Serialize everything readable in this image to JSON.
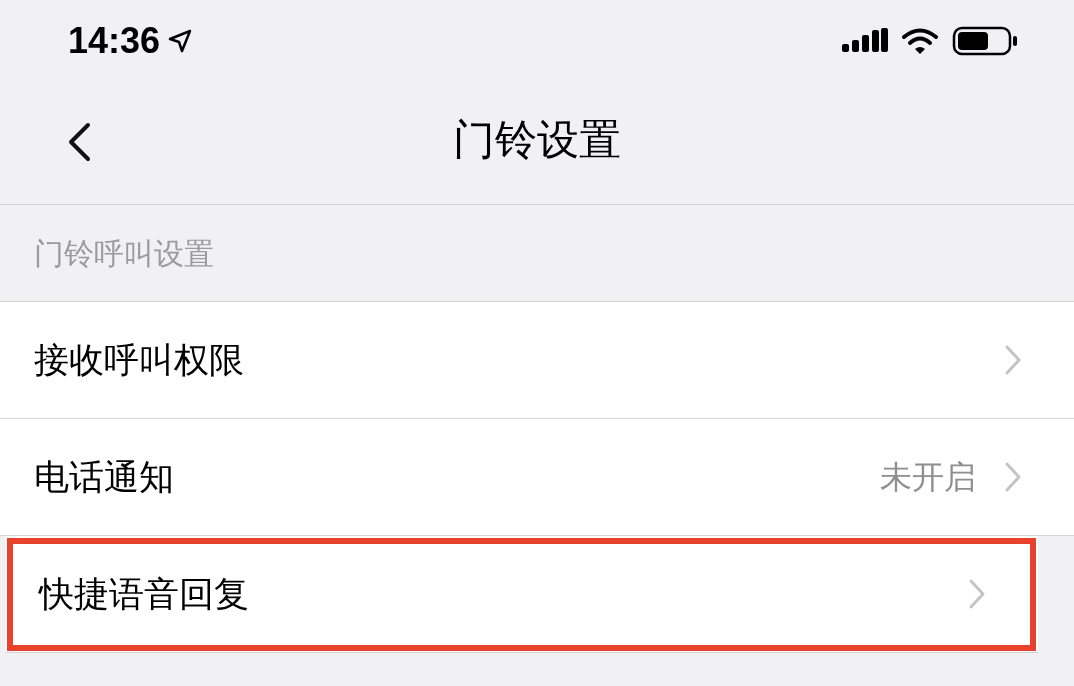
{
  "status_bar": {
    "time": "14:36"
  },
  "nav": {
    "title": "门铃设置"
  },
  "section": {
    "header": "门铃呼叫设置"
  },
  "rows": [
    {
      "label": "接收呼叫权限",
      "highlighted": false
    },
    {
      "label": "电话通知",
      "value": "未开启",
      "highlighted": false
    },
    {
      "label": "快捷语音回复",
      "highlighted": true
    }
  ]
}
